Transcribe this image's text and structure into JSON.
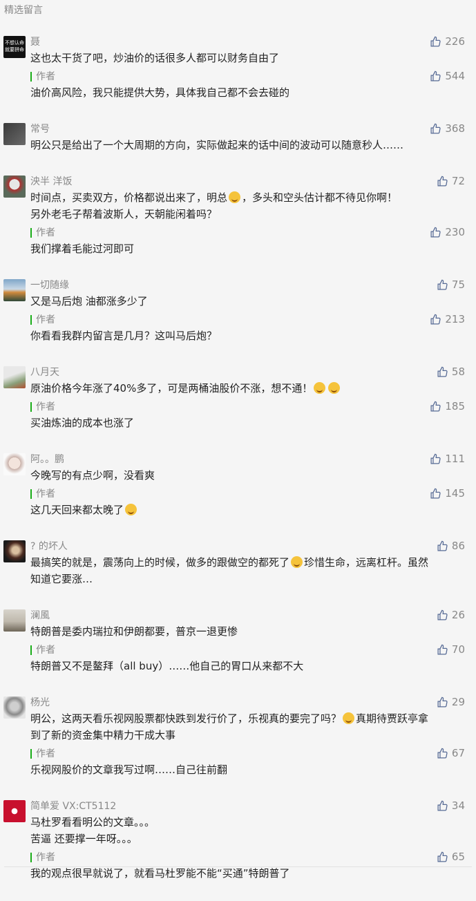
{
  "header": {
    "title": "精选留言"
  },
  "comments": [
    {
      "nick": "聂",
      "avatar": "text-avatar",
      "avatar_text": "不想认命\n就要拼命",
      "text": "这也太干货了吧，炒油价的话很多人都可以财务自由了",
      "likes": "226",
      "reply": {
        "label": "作者",
        "text": "油价高风险，我只能提供大势，具体我自己都不会去碰的",
        "likes": "544"
      }
    },
    {
      "nick": "常号",
      "avatar": "dark-avatar",
      "text": "明公只是给出了一个大周期的方向，实际做起来的话中间的波动可以随意秒人……",
      "likes": "368"
    },
    {
      "nick": "泱半 洋饭 ",
      "avatar": "photo-avatar-1",
      "text": "时间点，买卖双方，价格都说出来了，明总",
      "text_after_emoji": "，多头和空头估计都不待见你啊！",
      "text2": "另外老毛子帮着波斯人，天朝能闲着吗？",
      "likes": "72",
      "reply": {
        "label": "作者",
        "text": "我们撑着毛能过河即可",
        "likes": "230"
      }
    },
    {
      "nick": "一切随缘",
      "avatar": "landscape-avatar",
      "text": "又是马后炮 油都涨多少了",
      "likes": "75",
      "reply": {
        "label": "作者",
        "text": "你看看我群内留言是几月？这叫马后炮？",
        "likes": "213"
      }
    },
    {
      "nick": "八月天",
      "avatar": "photo-avatar-2",
      "text": "原油价格今年涨了40%多了，可是两桶油股价不涨，想不通！",
      "likes": "58",
      "reply": {
        "label": "作者",
        "text": "买油炼油的成本也涨了",
        "likes": "185"
      }
    },
    {
      "nick": "阿。。鹏",
      "avatar": "photo-avatar-3",
      "text": "今晚写的有点少啊，没看爽",
      "likes": "111",
      "reply": {
        "label": "作者",
        "text": "这几天回来都太晚了",
        "likes": "145"
      }
    },
    {
      "nick": "? 的坏人",
      "avatar": "photo-avatar-4",
      "text": "最搞笑的就是，震荡向上的时候，做多的跟做空的都死了",
      "text_after_emoji": "珍惜生命，远离杠杆。虽然",
      "text2": "知道它要涨…",
      "likes": "86"
    },
    {
      "nick": "澜風",
      "avatar": "mist-avatar",
      "text": "特朗普是委内瑞拉和伊朗都要，普京一退更惨",
      "likes": "26",
      "reply": {
        "label": "作者",
        "text": "特朗普又不是鳌拜（all buy）……他自己的胃口从来都不大",
        "likes": "70"
      }
    },
    {
      "nick": "杨光",
      "avatar": "sketch-avatar",
      "text": "明公，这两天看乐视网股票都快跌到发行价了，乐视真的要完了吗？",
      "text_after_emoji": "真期待贾跃亭拿",
      "text2": "到了新的资金集中精力干成大事",
      "likes": "29",
      "reply": {
        "label": "作者",
        "text": "乐视网股价的文章我写过啊……自己往前翻",
        "likes": "67"
      }
    },
    {
      "nick": "简单爱 VX:CT5112",
      "avatar": "cartoon-avatar",
      "text": "马杜罗看看明公的文章。。。",
      "text2": "苦逼 还要撑一年呀。。。",
      "likes": "34",
      "reply": {
        "label": "作者",
        "text": "我的观点很早就说了，就看马杜罗能不能“买通”特朗普了",
        "likes": "65"
      }
    }
  ],
  "colors": {
    "author_bar": "#1aad19",
    "muted": "#888888",
    "bg": "#f5f5f5"
  }
}
